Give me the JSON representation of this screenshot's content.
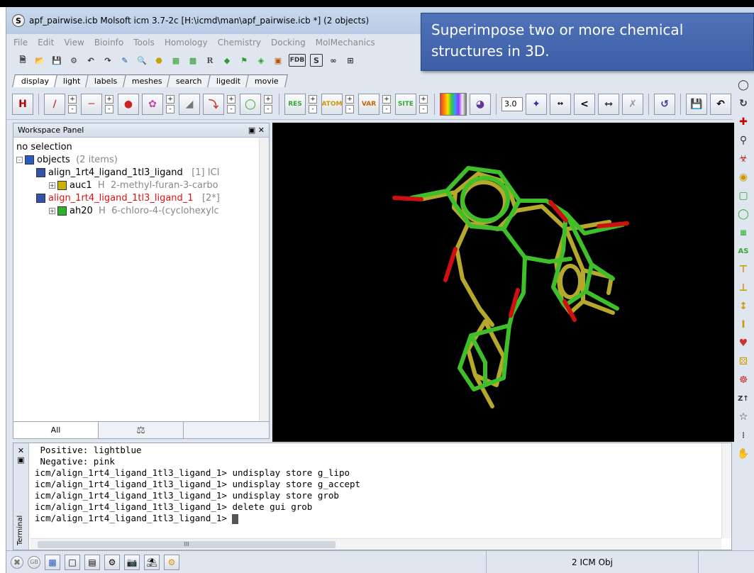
{
  "window": {
    "title": "apf_pairwise.icb Molsoft icm 3.7-2c  [H:\\icmd\\man\\apf_pairwise.icb *] (2 objects)",
    "app_icon": "S"
  },
  "callout": {
    "text": "Superimpose two or more chemical structures in 3D."
  },
  "menu": {
    "items": [
      "File",
      "Edit",
      "View",
      "Bioinfo",
      "Tools",
      "Homology",
      "Chemistry",
      "Docking",
      "MolMechanics"
    ]
  },
  "tabs": [
    "display",
    "light",
    "labels",
    "meshes",
    "search",
    "ligedit",
    "movie"
  ],
  "toolbar": {
    "number_field": "3.0"
  },
  "workspace": {
    "header": "Workspace Panel",
    "selection": "no selection",
    "root": {
      "label": "objects",
      "count": "(2 items)"
    },
    "objects": [
      {
        "name": "align_1rt4_ligand_1tl3_ligand",
        "meta": "[1] ICI",
        "child_name": "auc1",
        "child_type": "H",
        "child_desc": "2-methyl-furan-3-carbo"
      },
      {
        "name": "align_1rt4_ligand_1tl3_ligand_1",
        "meta": "[2*]",
        "child_name": "ah20",
        "child_type": "H",
        "child_desc": "6-chloro-4-(cyclohexylc"
      }
    ],
    "tab_all": "All"
  },
  "terminal": {
    "lines": [
      " Positive: lightblue",
      " Negative: pink",
      "icm/align_1rt4_ligand_1tl3_ligand_1> undisplay store g_lipo",
      "icm/align_1rt4_ligand_1tl3_ligand_1> undisplay store g_accept",
      "icm/align_1rt4_ligand_1tl3_ligand_1> undisplay store grob",
      "icm/align_1rt4_ligand_1tl3_ligand_1> delete gui grob",
      "icm/align_1rt4_ligand_1tl3_ligand_1> "
    ],
    "side_label": "Terminal",
    "scroll_marker": "III"
  },
  "status": {
    "objects": "2 ICM Obj"
  },
  "colors": {
    "green_ligand": "#3fbf2a",
    "olive_ligand": "#b5a82a",
    "oxygen_red": "#d01010",
    "callout_bg": "#4467ad"
  }
}
